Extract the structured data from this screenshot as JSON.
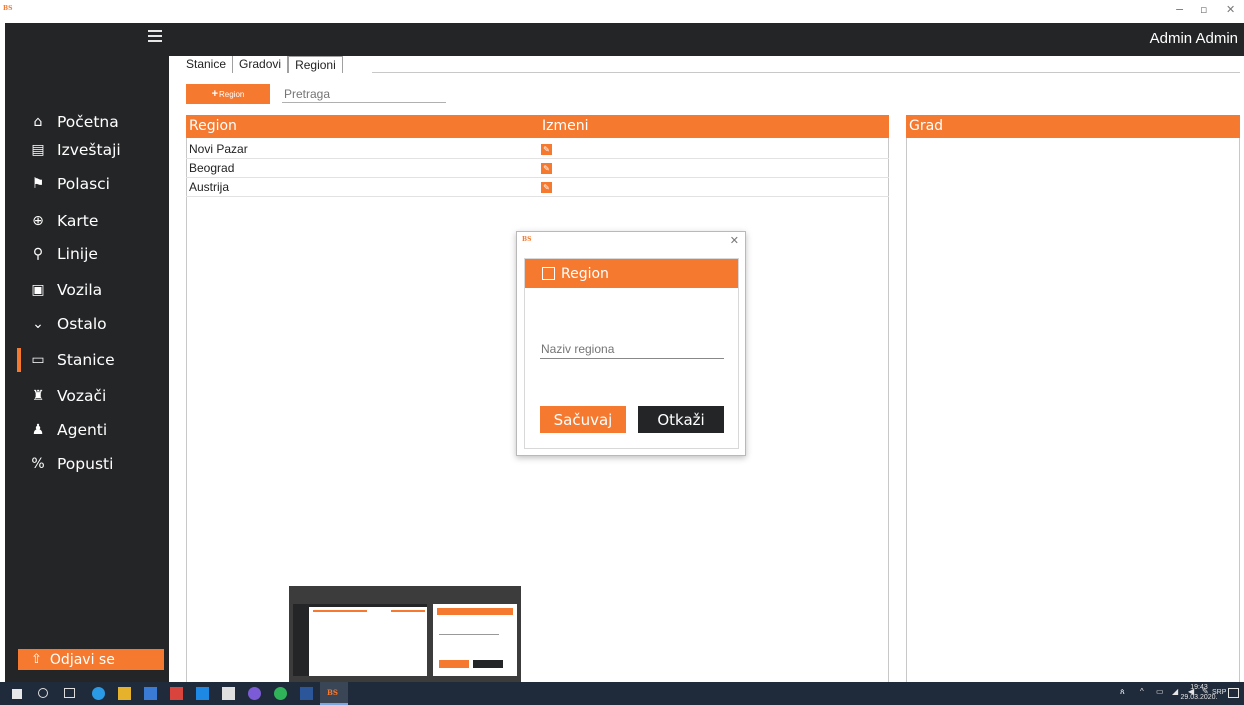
{
  "window": {
    "logo": "BS",
    "minimize": "−",
    "maximize": "▫",
    "close": "✕"
  },
  "user": {
    "name": "Admin Admin"
  },
  "sidebar": {
    "items": [
      {
        "label": "Početna",
        "icon": "home-icon",
        "glyph": "⌂"
      },
      {
        "label": "Izveštaji",
        "icon": "report-icon",
        "glyph": "▤"
      },
      {
        "label": "Polasci",
        "icon": "departures-icon",
        "glyph": "⚑"
      },
      {
        "label": "Karte",
        "icon": "ticket-icon",
        "glyph": "⊕"
      },
      {
        "label": "Linije",
        "icon": "route-icon",
        "glyph": "⚲"
      },
      {
        "label": "Vozila",
        "icon": "bus-icon",
        "glyph": "▣"
      },
      {
        "label": "Ostalo",
        "icon": "chevron-down-icon",
        "glyph": "⌄"
      },
      {
        "label": "Stanice",
        "icon": "station-icon",
        "glyph": "▭"
      },
      {
        "label": "Vozači",
        "icon": "driver-icon",
        "glyph": "♜"
      },
      {
        "label": "Agenti",
        "icon": "agent-icon",
        "glyph": "♟"
      },
      {
        "label": "Popusti",
        "icon": "percent-icon",
        "glyph": "%"
      }
    ],
    "active": "Stanice",
    "logout_label": "Odjavi se"
  },
  "tabs": [
    {
      "label": "Stanice"
    },
    {
      "label": "Gradovi"
    },
    {
      "label": "Regioni"
    }
  ],
  "toolbar": {
    "add_label": "Region",
    "search_placeholder": "Pretraga"
  },
  "table": {
    "columns": [
      "Region",
      "Izmeni"
    ],
    "rows": [
      {
        "region": "Novi Pazar"
      },
      {
        "region": "Beograd"
      },
      {
        "region": "Austrija"
      }
    ]
  },
  "grad_panel": {
    "header": "Grad"
  },
  "dialog": {
    "logo": "BS",
    "title": "Region",
    "input_placeholder": "Naziv regiona",
    "save_label": "Sačuvaj",
    "cancel_label": "Otkaži"
  },
  "taskbar": {
    "time": "19:43",
    "date": "29.03.2020.",
    "lang": "SRP",
    "app_label": "BS"
  },
  "colors": {
    "accent": "#f5792f",
    "dark": "#242526",
    "taskbar": "#1f2a3a"
  }
}
